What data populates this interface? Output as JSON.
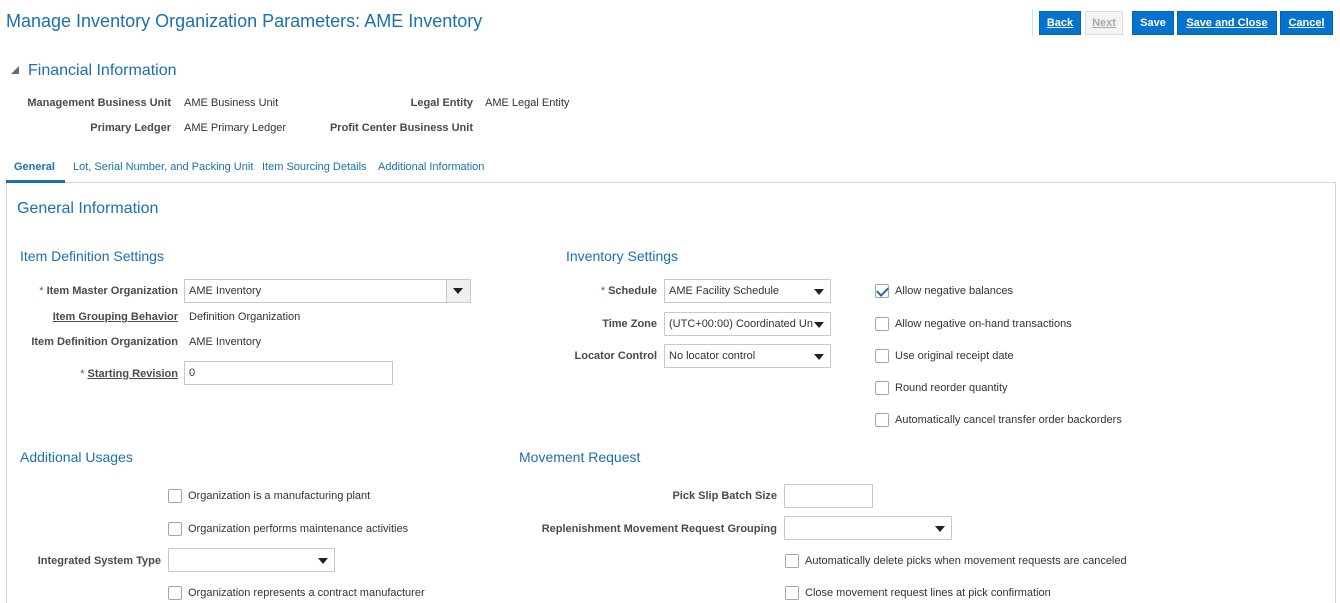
{
  "page": {
    "title": "Manage Inventory Organization Parameters: AME Inventory"
  },
  "toolbar": {
    "back_label": "Back",
    "next_label": "Next",
    "save_label": "Save",
    "save_close_label": "Save and Close",
    "cancel_label": "Cancel"
  },
  "financial": {
    "title": "Financial Information",
    "mbu_label": "Management Business Unit",
    "mbu_value": "AME Business Unit",
    "legal_entity_label": "Legal Entity",
    "legal_entity_value": "AME Legal Entity",
    "primary_ledger_label": "Primary Ledger",
    "primary_ledger_value": "AME Primary Ledger",
    "profit_center_label": "Profit Center Business Unit",
    "profit_center_value": ""
  },
  "tabs": [
    {
      "label": "General",
      "active": true
    },
    {
      "label": "Lot, Serial Number, and Packing Unit",
      "active": false
    },
    {
      "label": "Item Sourcing Details",
      "active": false
    },
    {
      "label": "Additional Information",
      "active": false
    }
  ],
  "general": {
    "title": "General Information",
    "required_marker": "*"
  },
  "item_def": {
    "title": "Item Definition Settings",
    "item_master_org_label": "Item Master Organization",
    "item_master_org_value": "AME Inventory",
    "item_grouping_label": "Item Grouping Behavior",
    "item_grouping_value": "Definition Organization",
    "item_def_org_label": "Item Definition Organization",
    "item_def_org_value": "AME Inventory",
    "starting_revision_label": "Starting Revision",
    "starting_revision_value": "0"
  },
  "inventory": {
    "title": "Inventory Settings",
    "schedule_label": "Schedule",
    "schedule_value": "AME Facility Schedule",
    "time_zone_label": "Time Zone",
    "time_zone_value": "(UTC+00:00) Coordinated Un",
    "locator_label": "Locator Control",
    "locator_value": "No locator control",
    "checkboxes": [
      {
        "label": "Allow negative balances",
        "checked": true
      },
      {
        "label": "Allow negative on-hand transactions",
        "checked": false
      },
      {
        "label": "Use original receipt date",
        "checked": false
      },
      {
        "label": "Round reorder quantity",
        "checked": false
      },
      {
        "label": "Automatically cancel transfer order backorders",
        "checked": false
      }
    ]
  },
  "usages": {
    "title": "Additional Usages",
    "mfg_plant_label": "Organization is a manufacturing plant",
    "maintenance_label": "Organization performs maintenance activities",
    "integrated_label": "Integrated System Type",
    "integrated_value": "",
    "contract_mfg_label": "Organization represents a contract manufacturer"
  },
  "movement": {
    "title": "Movement Request",
    "pick_slip_label": "Pick Slip Batch Size",
    "pick_slip_value": "",
    "replenishment_label": "Replenishment Movement Request Grouping",
    "replenishment_value": "",
    "auto_delete_label": "Automatically delete picks when movement requests are canceled",
    "close_lines_label": "Close movement request lines at pick confirmation"
  },
  "colors": {
    "accent": "#1a6fb5",
    "button": "#0572ce"
  }
}
